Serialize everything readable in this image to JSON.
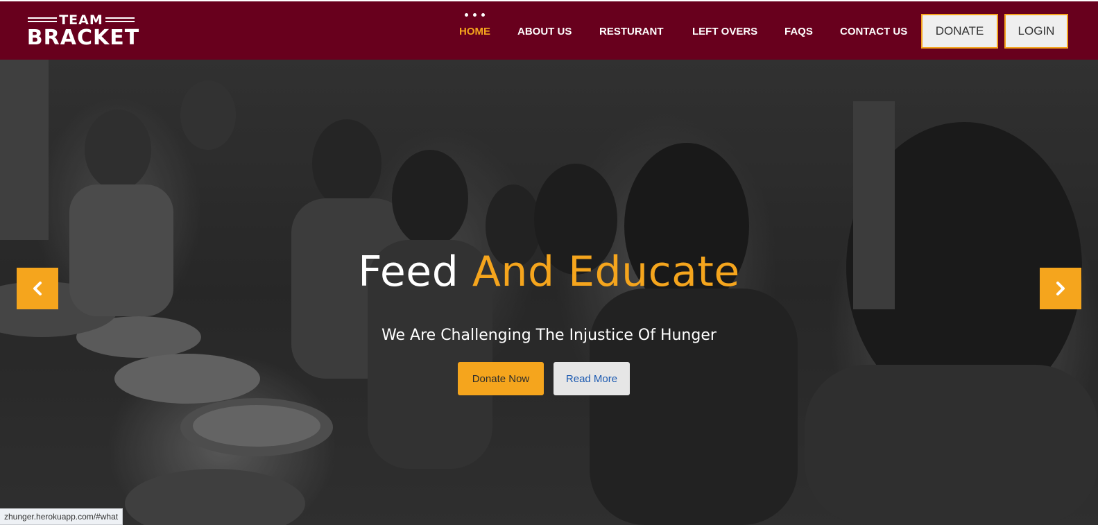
{
  "brand": {
    "line1": "TEAM",
    "line2": "BRACKET"
  },
  "nav": {
    "items": [
      {
        "label": "HOME",
        "active": true
      },
      {
        "label": "ABOUT US",
        "active": false
      },
      {
        "label": "RESTURANT",
        "active": false
      },
      {
        "label": "LEFT OVERS",
        "active": false
      },
      {
        "label": "FAQS",
        "active": false
      },
      {
        "label": "CONTACT US",
        "active": false
      }
    ],
    "donate_label": "DONATE",
    "login_label": "LOGIN"
  },
  "hero": {
    "title_white": "Feed",
    "title_accent": "And Educate",
    "subtitle": "We Are Challenging The Injustice Of Hunger",
    "primary_btn": "Donate Now",
    "secondary_btn": "Read More",
    "prev_icon": "chevron-left-icon",
    "next_icon": "chevron-right-icon"
  },
  "status_url": "zhunger.herokuapp.com/#what",
  "colors": {
    "header_bg": "#68001d",
    "accent": "#f5a51d",
    "link_blue": "#1b59b0"
  }
}
